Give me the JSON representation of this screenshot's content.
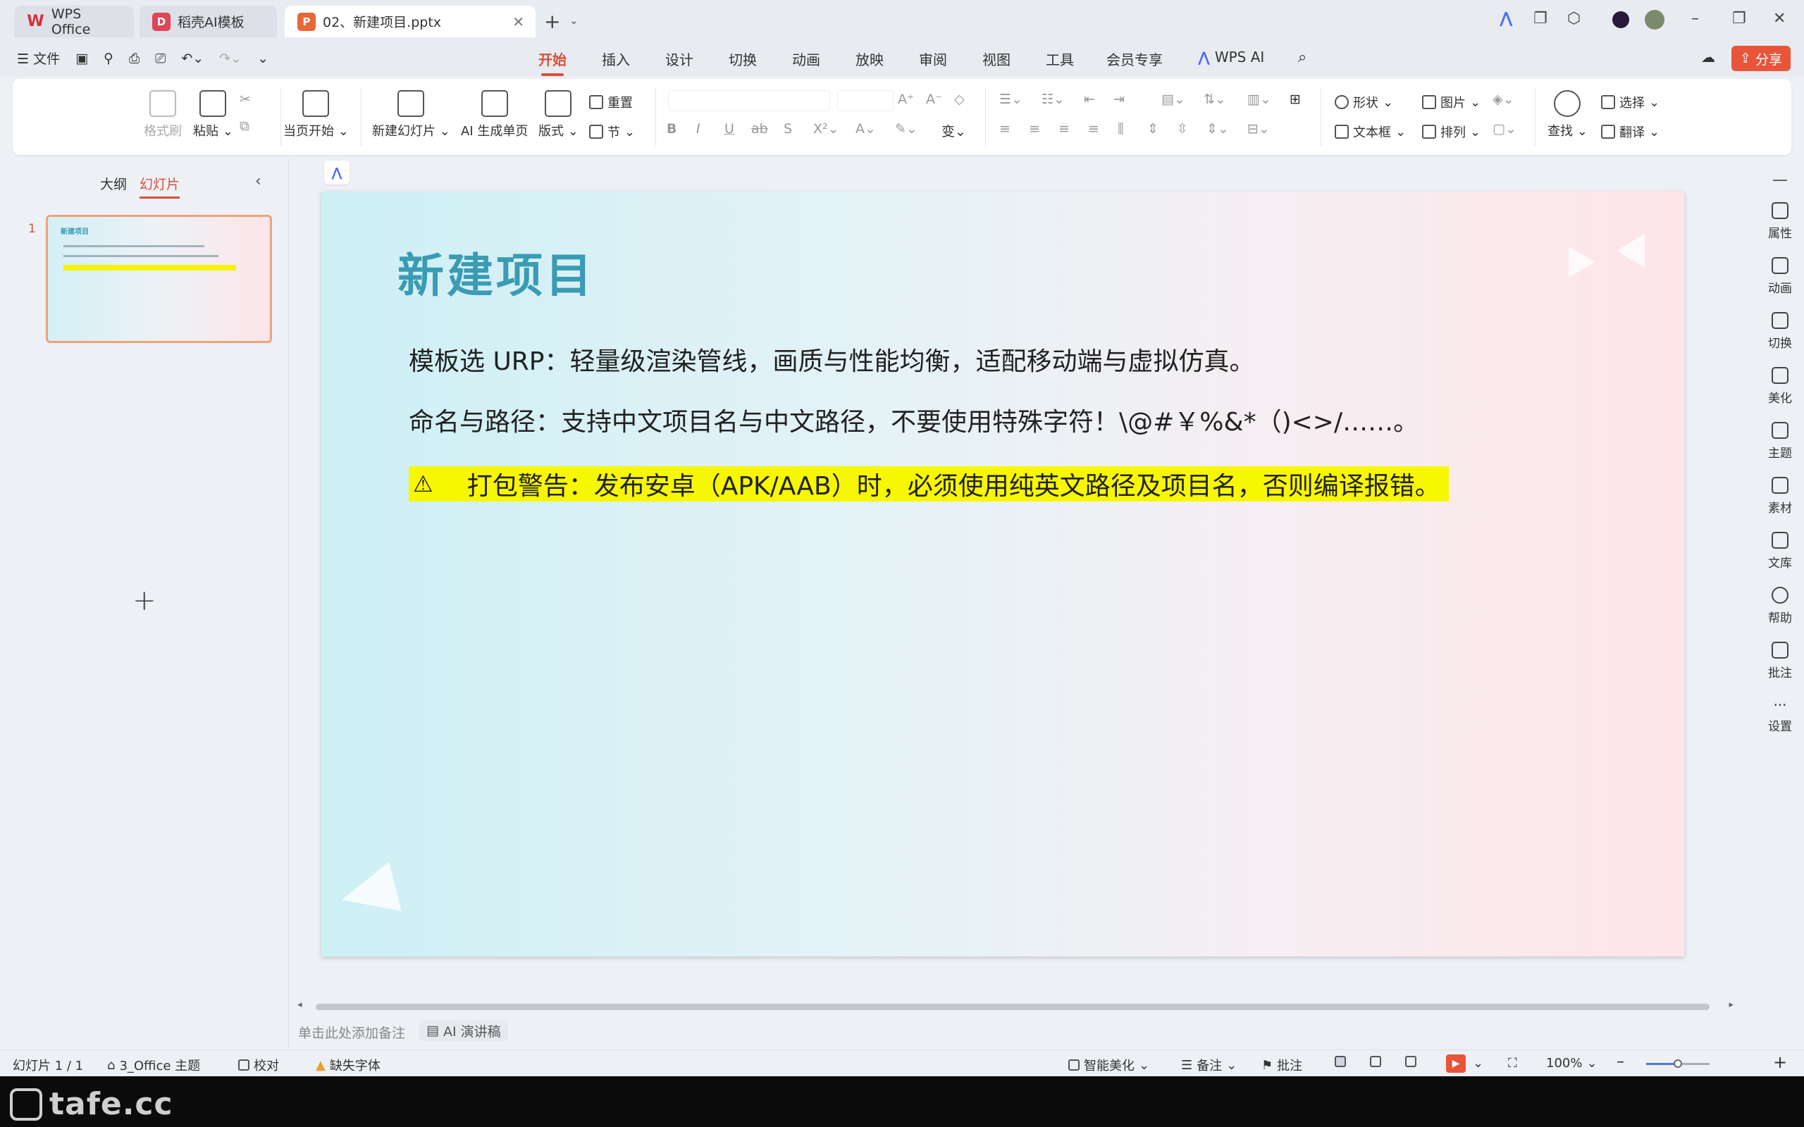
{
  "tabs": [
    {
      "label": "WPS Office",
      "icon": "wps-logo-icon"
    },
    {
      "label": "稻壳AI模板",
      "icon": "docer-icon"
    },
    {
      "label": "02、新建项目.pptx",
      "icon": "pptx-file-icon",
      "active": true
    }
  ],
  "menubar": {
    "file_label": "文件",
    "tabs": [
      "开始",
      "插入",
      "设计",
      "切换",
      "动画",
      "放映",
      "审阅",
      "视图",
      "工具",
      "会员专享"
    ],
    "ai_label": "WPS AI",
    "share_label": "分享"
  },
  "ribbon": {
    "format_painter": "格式刷",
    "paste": "粘贴",
    "start_from_current": "当页开始",
    "new_slide": "新建幻灯片",
    "ai_single_page": "AI 生成单页",
    "layout": "版式",
    "reset": "重置",
    "section": "节",
    "shape": "形状",
    "picture": "图片",
    "textbox": "文本框",
    "arrange": "排列",
    "find": "查找",
    "select": "选择",
    "translate": "翻译"
  },
  "left_panel": {
    "outline_tab": "大纲",
    "slides_tab": "幻灯片",
    "slide_number": "1"
  },
  "slide": {
    "title": "新建项目",
    "line1": "模板选 URP：轻量级渲染管线，画质与性能均衡，适配移动端与虚拟仿真。",
    "line2": "命名与路径：支持中文项目名与中文路径，不要使用特殊字符！\\@#￥%&*（)<>/……。",
    "warning_icon": "⚠",
    "warning": "打包警告：发布安卓（APK/AAB）时，必须使用纯英文路径及项目名，否则编译报错。"
  },
  "notes": {
    "placeholder": "单击此处添加备注",
    "ai_notes": "AI 演讲稿"
  },
  "right_rail": [
    "属性",
    "动画",
    "切换",
    "美化",
    "主题",
    "素材",
    "文库",
    "帮助",
    "批注",
    "设置"
  ],
  "statusbar": {
    "slide_count": "幻灯片 1 / 1",
    "theme": "3_Office 主题",
    "proofread": "校对",
    "missing_font": "缺失字体",
    "smart_beautify": "智能美化",
    "notes": "备注",
    "comments": "批注",
    "zoom": "100%",
    "zoom_level": 0.5
  },
  "watermark": "tafe.cc",
  "colors": {
    "accent": "#d6503a",
    "title": "#3a9bb5",
    "highlight": "#f7f700",
    "share": "#e8553a"
  }
}
